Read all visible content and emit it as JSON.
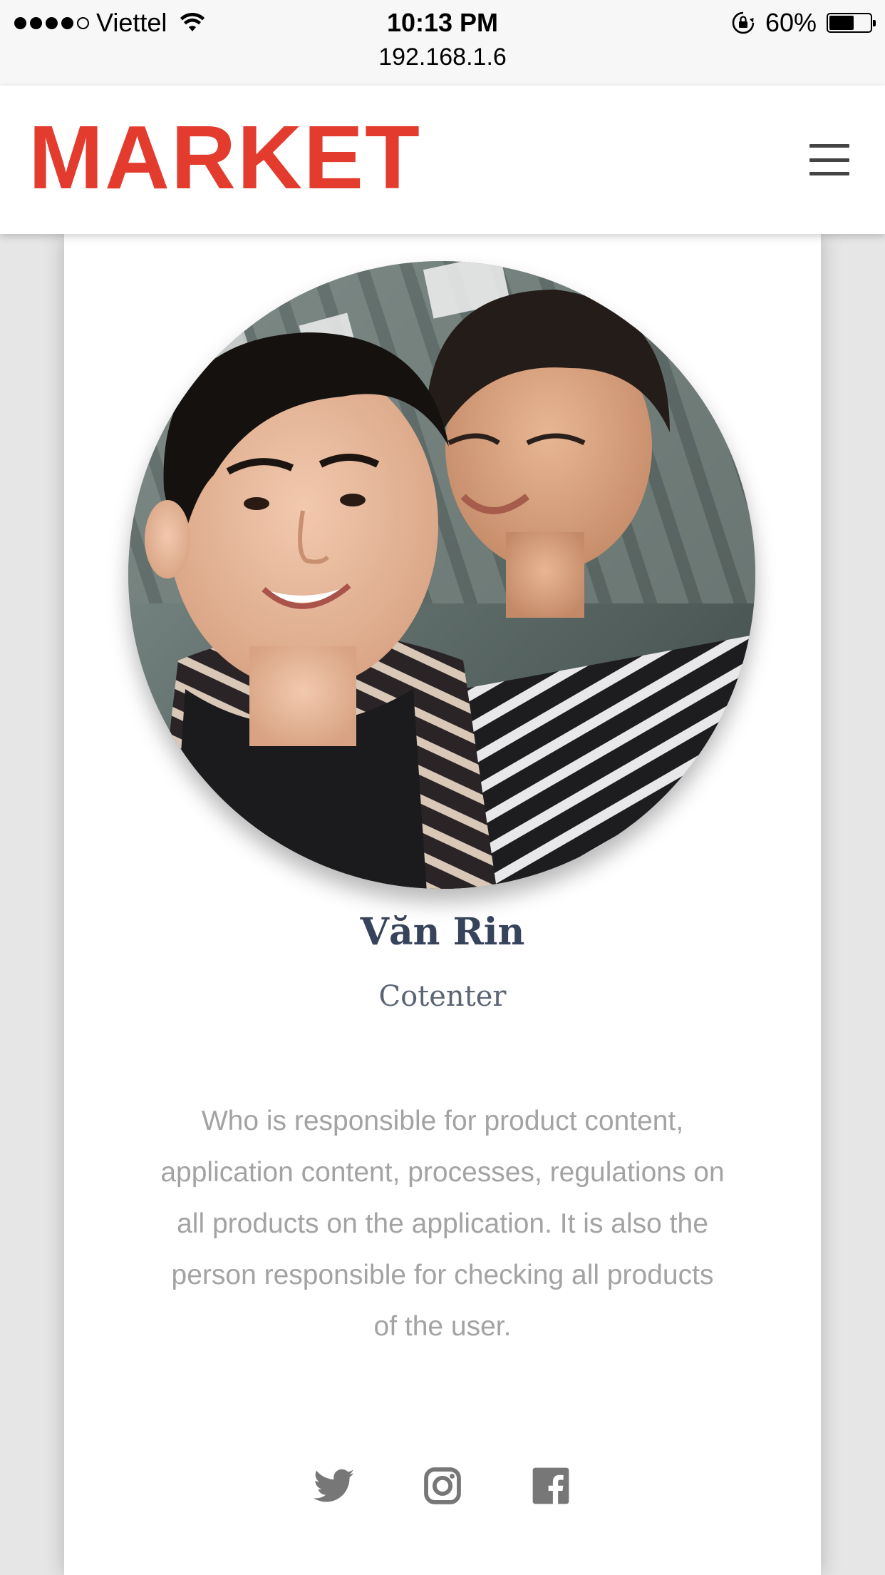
{
  "status_bar": {
    "carrier": "Viettel",
    "time": "10:13 PM",
    "battery_percent": "60%",
    "battery_level": 0.6,
    "url": "192.168.1.6"
  },
  "navbar": {
    "logo_text": "MARKET",
    "logo_color": "#e33b2e",
    "menu_icon": "hamburger-menu-icon"
  },
  "profile": {
    "name": "Văn Rin",
    "role": "Cotenter",
    "bio": "Who is responsible for product content, application content, processes, regulations on all products on the application. It is also the person responsible for checking all products of the user.",
    "social_icons": [
      "twitter-icon",
      "instagram-icon",
      "facebook-icon"
    ]
  }
}
